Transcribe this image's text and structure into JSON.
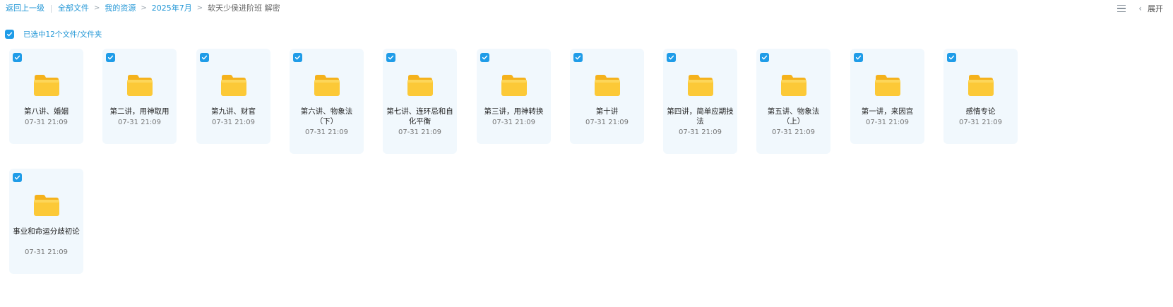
{
  "breadcrumb": {
    "back": "返回上一级",
    "items": [
      "全部文件",
      "我的资源",
      "2025年7月"
    ],
    "current": "软天少侯进阶班 解密"
  },
  "toolbar": {
    "expand_label": "展开"
  },
  "selection": {
    "text": "已选中12个文件/文件夹"
  },
  "colors": {
    "accent": "#1f9ce8",
    "card_bg": "#f1f8fd",
    "folder": "#fbc531"
  },
  "folders": [
    {
      "name": "第八讲、婚姻",
      "date": "07-31 21:09"
    },
    {
      "name": "第二讲，用神取用",
      "date": "07-31 21:09"
    },
    {
      "name": "第九讲、财官",
      "date": "07-31 21:09"
    },
    {
      "name": "第六讲、物象法（下）",
      "date": "07-31 21:09"
    },
    {
      "name": "第七讲、连环忌和自化平衡",
      "date": "07-31 21:09"
    },
    {
      "name": "第三讲，用神转换",
      "date": "07-31 21:09"
    },
    {
      "name": "第十讲",
      "date": "07-31 21:09"
    },
    {
      "name": "第四讲，简单应期技法",
      "date": "07-31 21:09"
    },
    {
      "name": "第五讲、物象法（上）",
      "date": "07-31 21:09"
    },
    {
      "name": "第一讲，来因宫",
      "date": "07-31 21:09"
    },
    {
      "name": "感情专论",
      "date": "07-31 21:09"
    },
    {
      "name": "事业和命运分歧初论",
      "date": "07-31 21:09"
    }
  ]
}
